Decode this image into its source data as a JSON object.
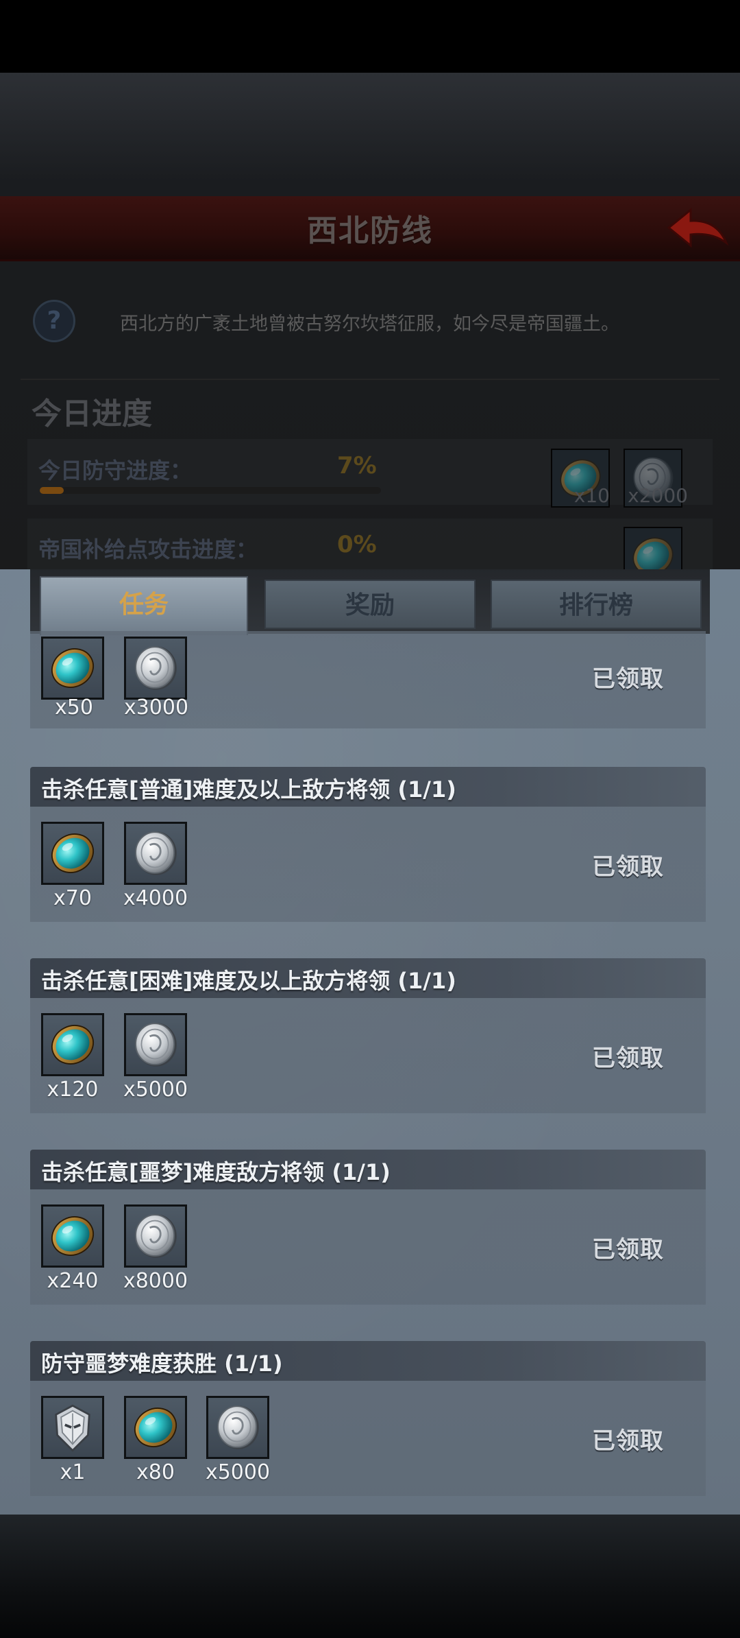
{
  "screen": {
    "title": "西北防线",
    "description": "西北方的广袤土地曾被古努尔坎塔征服，如今尽是帝国疆土。",
    "help_symbol": "?",
    "today_progress_title": "今日进度",
    "progress": [
      {
        "label": "今日防守进度：",
        "percent_text": "7%",
        "value": 0.07,
        "rewards": [
          {
            "icon": "gem-icon",
            "qty": "x10"
          },
          {
            "icon": "silver-coin-icon",
            "qty": "x2000"
          }
        ]
      },
      {
        "label": "帝国补给点攻击进度：",
        "percent_text": "0%",
        "value": 0.0,
        "rewards": [
          {
            "icon": "gem-icon",
            "qty": ""
          }
        ]
      }
    ]
  },
  "tabs": [
    {
      "label": "任务",
      "active": true
    },
    {
      "label": "奖励",
      "active": false
    },
    {
      "label": "排行榜",
      "active": false
    }
  ],
  "quests": [
    {
      "title": "",
      "rewards": [
        {
          "icon": "gem-icon",
          "qty": "x50"
        },
        {
          "icon": "silver-coin-icon",
          "qty": "x3000"
        }
      ],
      "status": "已领取"
    },
    {
      "title": "击杀任意[普通]难度及以上敌方将领 (1/1)",
      "rewards": [
        {
          "icon": "gem-icon",
          "qty": "x70"
        },
        {
          "icon": "silver-coin-icon",
          "qty": "x4000"
        }
      ],
      "status": "已领取"
    },
    {
      "title": "击杀任意[困难]难度及以上敌方将领 (1/1)",
      "rewards": [
        {
          "icon": "gem-icon",
          "qty": "x120"
        },
        {
          "icon": "silver-coin-icon",
          "qty": "x5000"
        }
      ],
      "status": "已领取"
    },
    {
      "title": "击杀任意[噩梦]难度敌方将领 (1/1)",
      "rewards": [
        {
          "icon": "gem-icon",
          "qty": "x240"
        },
        {
          "icon": "silver-coin-icon",
          "qty": "x8000"
        }
      ],
      "status": "已领取"
    },
    {
      "title": "防守噩梦难度获胜 (1/1)",
      "rewards": [
        {
          "icon": "helmet-icon",
          "qty": "x1"
        },
        {
          "icon": "gem-icon",
          "qty": "x80"
        },
        {
          "icon": "silver-coin-icon",
          "qty": "x5000"
        }
      ],
      "status": "已领取"
    }
  ],
  "colors": {
    "active_tab_text": "#d5a24a",
    "title_bar": "#3a1210",
    "gem": "#2fc4c8",
    "coin": "#c8ccd0"
  }
}
